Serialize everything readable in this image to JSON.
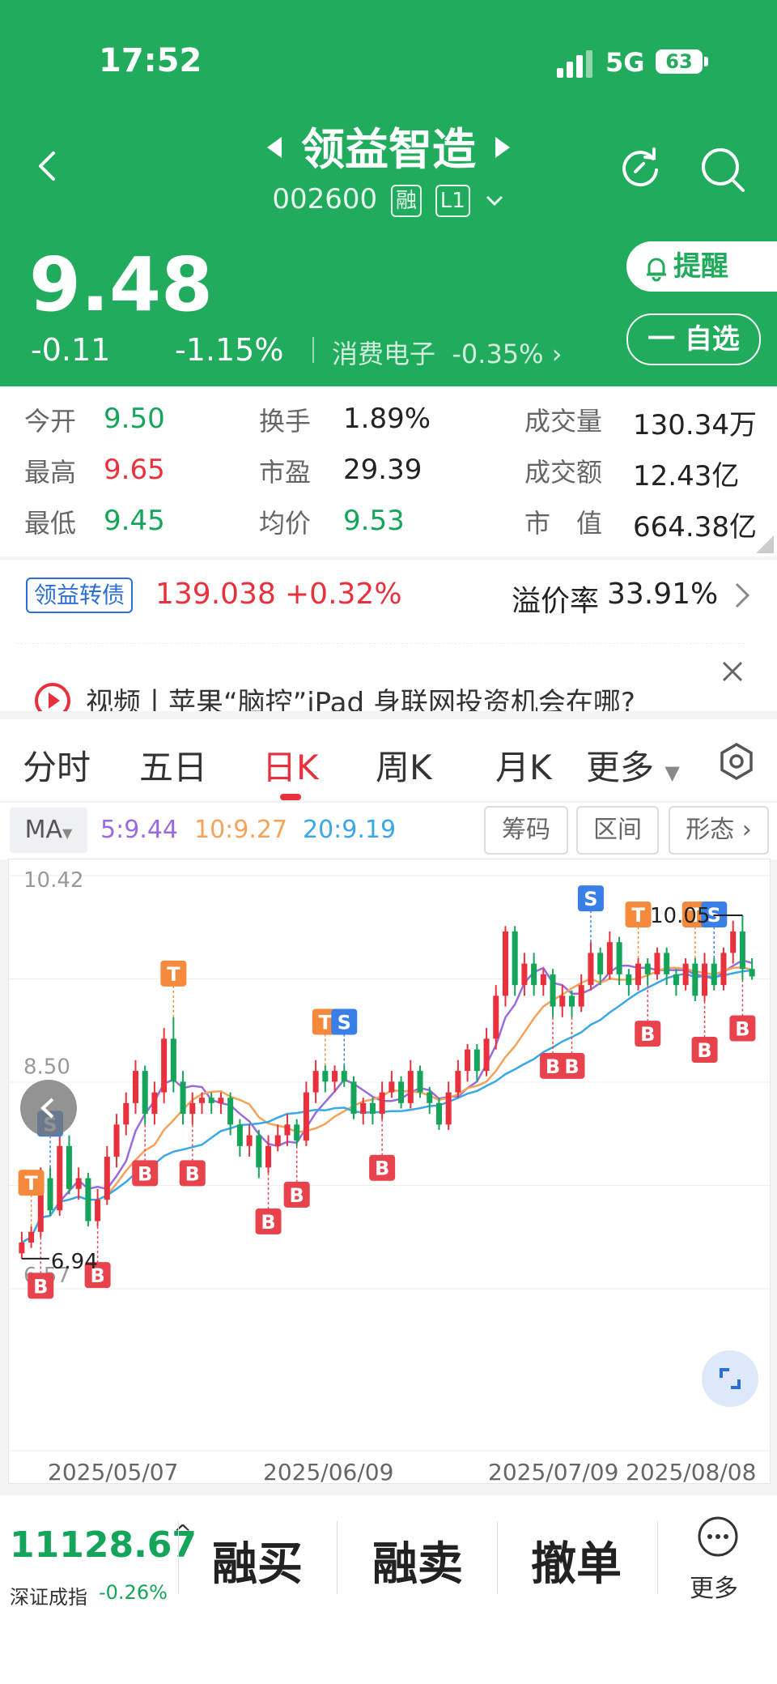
{
  "status_bar": {
    "time": "17:52",
    "network": "5G",
    "battery": "63"
  },
  "header": {
    "title": "领益智造",
    "code": "002600",
    "badge_margin": "融",
    "badge_level": "L1",
    "price": "9.48",
    "change": "-0.11",
    "change_pct": "-1.15%",
    "sector": "消费电子",
    "sector_pct": "-0.35%",
    "remind_label": "提醒",
    "fav_label": "一 自选"
  },
  "stats": [
    {
      "label": "今开",
      "value": "9.50"
    },
    {
      "label": "换手",
      "value": "1.89%"
    },
    {
      "label": "成交量",
      "value": "130.34万"
    },
    {
      "label": "最高",
      "value": "9.65"
    },
    {
      "label": "市盈",
      "value": "29.39"
    },
    {
      "label": "成交额",
      "value": "12.43亿"
    },
    {
      "label": "最低",
      "value": "9.45"
    },
    {
      "label": "均价",
      "value": "9.53"
    },
    {
      "label": "市　值",
      "value": "664.38亿"
    }
  ],
  "bond": {
    "name": "领益转债",
    "price": "139.038",
    "pct": "+0.32%",
    "premium_label": "溢价率",
    "premium": "33.91%"
  },
  "news": {
    "text": "视频丨苹果“脑控”iPad 身联网投资机会在哪?"
  },
  "tabs": [
    "分时",
    "五日",
    "日K",
    "周K",
    "月K",
    "更多"
  ],
  "active_tab": "日K",
  "ma": {
    "label": "MA",
    "ma5": "5:9.44",
    "ma10": "10:9.27",
    "ma20": "20:9.19",
    "tools": [
      "筹码",
      "区间",
      "形态"
    ]
  },
  "chart_data": {
    "type": "candlestick",
    "y_axis_labels": [
      "10.42",
      "8.50",
      "6.57"
    ],
    "dates": [
      "2025/05/07",
      "2025/06/09",
      "2025/07/09",
      "2025/08/08"
    ],
    "high_marker": "10.05",
    "low_marker": "6.94",
    "ylim": [
      6.57,
      10.42
    ],
    "colors": {
      "up": "#e8313c",
      "down": "#14a55a",
      "ma5": "#9a6be0",
      "ma10": "#f5a25a",
      "ma20": "#3aa8e8"
    },
    "candles": [
      [
        6.9,
        7.0,
        7.1,
        6.85
      ],
      [
        7.0,
        7.1,
        7.15,
        6.95
      ],
      [
        7.1,
        7.6,
        7.7,
        7.05
      ],
      [
        7.6,
        7.3,
        7.7,
        7.25
      ],
      [
        7.3,
        7.9,
        8.0,
        7.25
      ],
      [
        7.9,
        7.5,
        8.0,
        7.45
      ],
      [
        7.5,
        7.6,
        7.7,
        7.4
      ],
      [
        7.6,
        7.2,
        7.65,
        7.15
      ],
      [
        7.2,
        7.4,
        7.5,
        7.15
      ],
      [
        7.4,
        7.8,
        7.9,
        7.35
      ],
      [
        7.8,
        8.1,
        8.2,
        7.7
      ],
      [
        8.1,
        8.3,
        8.4,
        8.0
      ],
      [
        8.3,
        8.6,
        8.7,
        8.2
      ],
      [
        8.6,
        8.2,
        8.65,
        8.1
      ],
      [
        8.2,
        8.4,
        8.5,
        8.1
      ],
      [
        8.4,
        8.9,
        9.0,
        8.3
      ],
      [
        8.9,
        8.5,
        9.1,
        8.4
      ],
      [
        8.5,
        8.2,
        8.6,
        8.1
      ],
      [
        8.2,
        8.3,
        8.4,
        8.1
      ],
      [
        8.3,
        8.35,
        8.4,
        8.2
      ],
      [
        8.35,
        8.3,
        8.4,
        8.2
      ],
      [
        8.3,
        8.35,
        8.4,
        8.2
      ],
      [
        8.35,
        8.1,
        8.4,
        8.0
      ],
      [
        8.1,
        7.9,
        8.15,
        7.8
      ],
      [
        7.9,
        8.0,
        8.1,
        7.8
      ],
      [
        8.0,
        7.7,
        8.05,
        7.6
      ],
      [
        7.7,
        7.9,
        8.0,
        7.65
      ],
      [
        7.9,
        8.0,
        8.1,
        7.85
      ],
      [
        8.0,
        8.1,
        8.2,
        7.9
      ],
      [
        8.1,
        7.95,
        8.15,
        7.9
      ],
      [
        7.95,
        8.4,
        8.5,
        7.9
      ],
      [
        8.4,
        8.6,
        8.7,
        8.3
      ],
      [
        8.6,
        8.5,
        8.65,
        8.4
      ],
      [
        8.5,
        8.6,
        8.65,
        8.4
      ],
      [
        8.6,
        8.5,
        8.65,
        8.45
      ],
      [
        8.5,
        8.2,
        8.55,
        8.15
      ],
      [
        8.2,
        8.3,
        8.35,
        8.1
      ],
      [
        8.3,
        8.2,
        8.35,
        8.1
      ],
      [
        8.2,
        8.4,
        8.5,
        8.15
      ],
      [
        8.4,
        8.5,
        8.6,
        8.35
      ],
      [
        8.5,
        8.3,
        8.55,
        8.25
      ],
      [
        8.3,
        8.6,
        8.7,
        8.25
      ],
      [
        8.6,
        8.4,
        8.65,
        8.35
      ],
      [
        8.4,
        8.3,
        8.45,
        8.2
      ],
      [
        8.3,
        8.1,
        8.35,
        8.05
      ],
      [
        8.1,
        8.4,
        8.5,
        8.05
      ],
      [
        8.4,
        8.6,
        8.7,
        8.35
      ],
      [
        8.6,
        8.8,
        8.85,
        8.5
      ],
      [
        8.8,
        8.6,
        8.85,
        8.5
      ],
      [
        8.6,
        8.9,
        9.0,
        8.55
      ],
      [
        8.9,
        9.3,
        9.4,
        8.8
      ],
      [
        9.3,
        9.9,
        9.95,
        9.2
      ],
      [
        9.9,
        9.4,
        9.95,
        9.3
      ],
      [
        9.4,
        9.6,
        9.7,
        9.3
      ],
      [
        9.6,
        9.4,
        9.7,
        9.3
      ],
      [
        9.4,
        9.5,
        9.55,
        9.3
      ],
      [
        9.5,
        9.2,
        9.55,
        9.1
      ],
      [
        9.2,
        9.3,
        9.4,
        9.1
      ],
      [
        9.3,
        9.2,
        9.35,
        9.1
      ],
      [
        9.2,
        9.4,
        9.5,
        9.15
      ],
      [
        9.4,
        9.7,
        9.8,
        9.35
      ],
      [
        9.7,
        9.5,
        9.75,
        9.4
      ],
      [
        9.5,
        9.8,
        9.9,
        9.45
      ],
      [
        9.8,
        9.5,
        9.85,
        9.4
      ],
      [
        9.5,
        9.4,
        9.55,
        9.3
      ],
      [
        9.4,
        9.6,
        9.65,
        9.35
      ],
      [
        9.6,
        9.5,
        9.65,
        9.4
      ],
      [
        9.5,
        9.7,
        9.75,
        9.45
      ],
      [
        9.7,
        9.5,
        9.75,
        9.4
      ],
      [
        9.5,
        9.4,
        9.55,
        9.3
      ],
      [
        9.4,
        9.6,
        9.65,
        9.35
      ],
      [
        9.6,
        9.3,
        9.65,
        9.25
      ],
      [
        9.3,
        9.6,
        9.7,
        9.25
      ],
      [
        9.6,
        9.4,
        9.65,
        9.35
      ],
      [
        9.4,
        9.7,
        9.75,
        9.35
      ],
      [
        9.7,
        9.9,
        10.0,
        9.6
      ],
      [
        9.9,
        9.55,
        10.05,
        9.45
      ],
      [
        9.55,
        9.48,
        9.65,
        9.45
      ]
    ],
    "signal_labels": [
      {
        "i": 1,
        "type": "T",
        "at": "high"
      },
      {
        "i": 3,
        "type": "S",
        "at": "high"
      },
      {
        "i": 16,
        "type": "T",
        "at": "high"
      },
      {
        "i": 32,
        "type": "T",
        "at": "high"
      },
      {
        "i": 34,
        "type": "S",
        "at": "high"
      },
      {
        "i": 60,
        "type": "S",
        "at": "high"
      },
      {
        "i": 65,
        "type": "T",
        "at": "high"
      },
      {
        "i": 71,
        "type": "T",
        "at": "high"
      },
      {
        "i": 73,
        "type": "S",
        "at": "high"
      },
      {
        "i": 78,
        "type": "T",
        "at": "high"
      },
      {
        "i": 2,
        "type": "B",
        "at": "low"
      },
      {
        "i": 8,
        "type": "B",
        "at": "low"
      },
      {
        "i": 13,
        "type": "B",
        "at": "low"
      },
      {
        "i": 18,
        "type": "B",
        "at": "low"
      },
      {
        "i": 26,
        "type": "B",
        "at": "low"
      },
      {
        "i": 29,
        "type": "B",
        "at": "low"
      },
      {
        "i": 38,
        "type": "B",
        "at": "low"
      },
      {
        "i": 56,
        "type": "B",
        "at": "low"
      },
      {
        "i": 58,
        "type": "B",
        "at": "low"
      },
      {
        "i": 66,
        "type": "B",
        "at": "low"
      },
      {
        "i": 72,
        "type": "B",
        "at": "low"
      },
      {
        "i": 76,
        "type": "B",
        "at": "low"
      }
    ]
  },
  "bottom": {
    "index_value": "11128.67",
    "index_name": "深证成指",
    "index_pct": "-0.26%",
    "buttons": [
      "融买",
      "融卖",
      "撤单"
    ],
    "more_label": "更多"
  }
}
